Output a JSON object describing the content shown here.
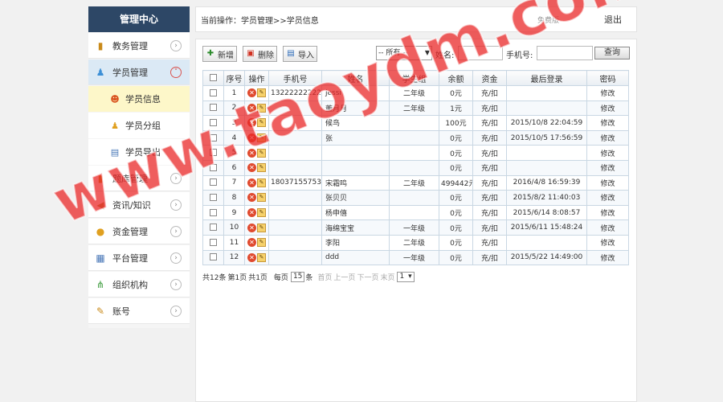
{
  "sidebar": {
    "title": "管理中心",
    "items": [
      {
        "label": "教务管理",
        "icon": "book-icon"
      },
      {
        "label": "学员管理",
        "icon": "users-icon"
      },
      {
        "label": "题库管理",
        "icon": "notebook-icon"
      },
      {
        "label": "资讯/知识",
        "icon": "megaphone-icon"
      },
      {
        "label": "资金管理",
        "icon": "coins-icon"
      },
      {
        "label": "平台管理",
        "icon": "calendar-icon"
      },
      {
        "label": "组织机构",
        "icon": "org-chart-icon"
      },
      {
        "label": "账号",
        "icon": "pencil-icon"
      }
    ],
    "subitems": [
      {
        "label": "学员信息",
        "icon": "person-icon"
      },
      {
        "label": "学员分组",
        "icon": "group-icon"
      },
      {
        "label": "学员导出",
        "icon": "export-icon"
      }
    ]
  },
  "topbar": {
    "breadcrumb": "当前操作：学员管理>>学员信息",
    "user": "免费版",
    "logout": "退出"
  },
  "toolbar": {
    "add": "新增",
    "delete": "删除",
    "import": "导入",
    "filter_value": "-- 所有 --",
    "name_label": "姓名:",
    "phone_label": "手机号:",
    "query": "查询"
  },
  "table": {
    "headers": [
      "",
      "序号",
      "操作",
      "手机号",
      "姓名",
      "学生组",
      "余额",
      "资金",
      "最后登录",
      "密码"
    ],
    "rows": [
      {
        "no": "1",
        "phone": "13222222222",
        "name": "jessi",
        "group": "二年级",
        "balance": "0元",
        "fund": "充/扣",
        "last": "",
        "pwd": "修改"
      },
      {
        "no": "2",
        "phone": "",
        "name": "董月月",
        "group": "二年级",
        "balance": "1元",
        "fund": "充/扣",
        "last": "",
        "pwd": "修改"
      },
      {
        "no": "3",
        "phone": "",
        "name": "候鸟",
        "group": "",
        "balance": "100元",
        "fund": "充/扣",
        "last": "2015/10/8 22:04:59",
        "pwd": "修改"
      },
      {
        "no": "4",
        "phone": "",
        "name": "张",
        "group": "",
        "balance": "0元",
        "fund": "充/扣",
        "last": "2015/10/5 17:56:59",
        "pwd": "修改"
      },
      {
        "no": "5",
        "phone": "",
        "name": "",
        "group": "",
        "balance": "0元",
        "fund": "充/扣",
        "last": "",
        "pwd": "修改"
      },
      {
        "no": "6",
        "phone": "",
        "name": "",
        "group": "",
        "balance": "0元",
        "fund": "充/扣",
        "last": "",
        "pwd": "修改"
      },
      {
        "no": "7",
        "phone": "18037155753",
        "name": "宋霜鸣",
        "group": "二年级",
        "balance": "499442元",
        "fund": "充/扣",
        "last": "2016/4/8 16:59:39",
        "pwd": "修改"
      },
      {
        "no": "8",
        "phone": "",
        "name": "张贝贝",
        "group": "",
        "balance": "0元",
        "fund": "充/扣",
        "last": "2015/8/2 11:40:03",
        "pwd": "修改"
      },
      {
        "no": "9",
        "phone": "",
        "name": "杨申僖",
        "group": "",
        "balance": "0元",
        "fund": "充/扣",
        "last": "2015/6/14 8:08:57",
        "pwd": "修改"
      },
      {
        "no": "10",
        "phone": "",
        "name": "海绵宝宝",
        "group": "一年级",
        "balance": "0元",
        "fund": "充/扣",
        "last": "2015/6/11 15:48:24",
        "pwd": "修改"
      },
      {
        "no": "11",
        "phone": "",
        "name": "李阳",
        "group": "二年级",
        "balance": "0元",
        "fund": "充/扣",
        "last": "",
        "pwd": "修改"
      },
      {
        "no": "12",
        "phone": "",
        "name": "ddd",
        "group": "一年级",
        "balance": "0元",
        "fund": "充/扣",
        "last": "2015/5/22 14:49:00",
        "pwd": "修改"
      }
    ]
  },
  "pager": {
    "total": "共12条",
    "page": "第1页",
    "pages": "共1页",
    "per_page_label": "每页",
    "per_page": "15",
    "per_page_unit": "条",
    "first": "首页",
    "prev": "上一页",
    "next": "下一页",
    "last": "末页",
    "goto": "1"
  },
  "watermark": "www.taoydm.com"
}
